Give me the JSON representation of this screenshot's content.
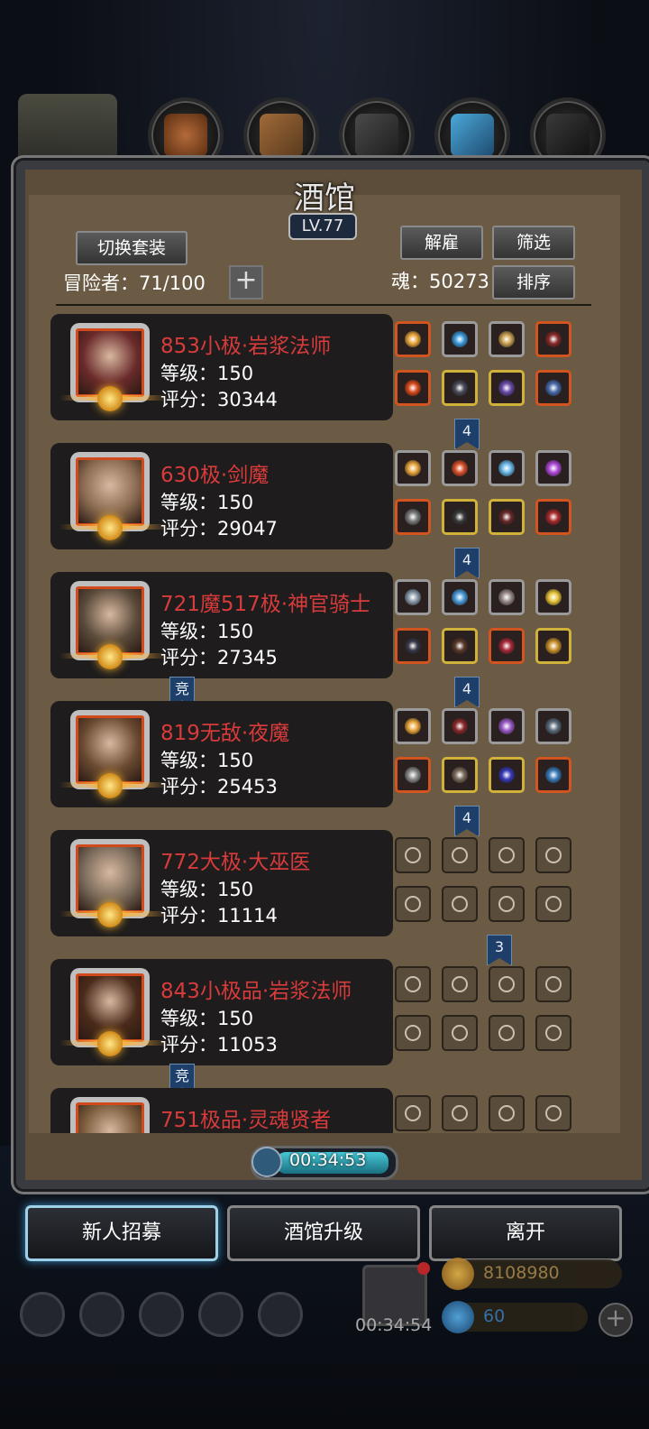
{
  "header": {
    "title": "酒馆",
    "level": "LV.77",
    "switch_outfit": "切换套装",
    "dismiss": "解雇",
    "filter": "筛选",
    "sort": "排序",
    "adventurers_label": "冒险者：71/100",
    "soul_label": "魂：50273"
  },
  "heroes": [
    {
      "name": "853小极·岩浆法师",
      "level": "等级：150",
      "score": "评分：30344",
      "banner": "4",
      "comp": ""
    },
    {
      "name": "630极·剑魔",
      "level": "等级：150",
      "score": "评分：29047",
      "banner": "4",
      "comp": ""
    },
    {
      "name": "721魔517极·神官骑士",
      "level": "等级：150",
      "score": "评分：27345",
      "banner": "4",
      "comp": "竞"
    },
    {
      "name": "819无敌·夜魔",
      "level": "等级：150",
      "score": "评分：25453",
      "banner": "4",
      "comp": ""
    },
    {
      "name": "772大极·大巫医",
      "level": "等级：150",
      "score": "评分：11114",
      "banner": "3",
      "comp": ""
    },
    {
      "name": "843小极品·岩浆法师",
      "level": "等级：150",
      "score": "评分：11053",
      "banner": "",
      "comp": "竞"
    },
    {
      "name": "751极品·灵魂贤者",
      "level": "",
      "score": "",
      "banner": "",
      "comp": ""
    }
  ],
  "timer": "00:34:53",
  "buttons": {
    "recruit": "新人招募",
    "upgrade": "酒馆升级",
    "leave": "离开"
  },
  "hud": {
    "gift_timer": "00:34:54",
    "gold": "8108980",
    "gems": "60"
  },
  "colors": {
    "name_red": "#d83b3b",
    "frame_brown": "#6b5b44",
    "banner_blue": "#1d3f6a"
  }
}
